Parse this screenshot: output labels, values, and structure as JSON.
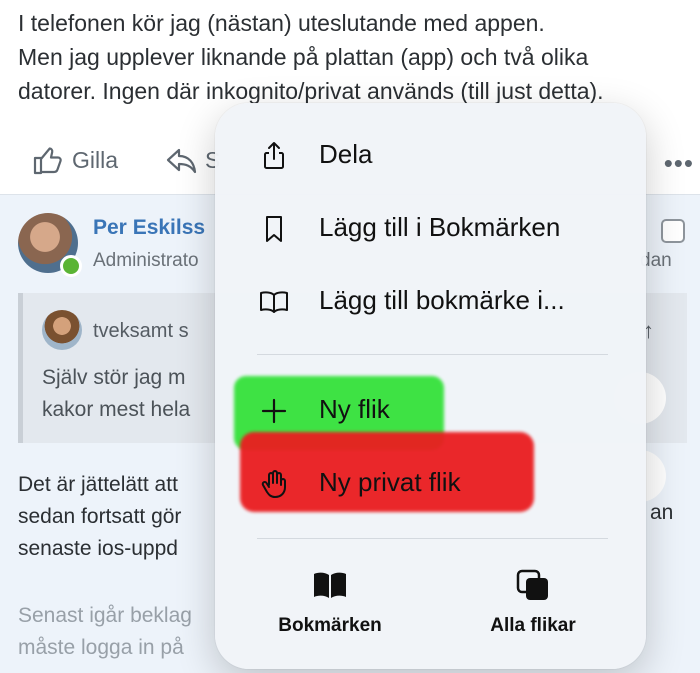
{
  "post": {
    "lines": [
      "I telefonen kör jag (nästan) uteslutande med appen.",
      "Men jag upplever liknande på plattan (app) och två olika",
      "datorer. Ingen där inkognito/privat används (till just detta)."
    ]
  },
  "actions": {
    "like_label": "Gilla",
    "reply_partial": "S",
    "more": "•••"
  },
  "reply": {
    "author": "Per Eskilss",
    "role": "Administrato",
    "date_partial": "dan",
    "quote": {
      "author": "tveksamt s",
      "lines": [
        "Själv stör jag m",
        "kakor mest hela"
      ]
    },
    "body_lines": [
      "Det är jättelätt att",
      "sedan fortsatt gör",
      "senaste ios-uppd"
    ],
    "body_right_fragment": "an",
    "faded_lines": [
      "Senast igår beklag",
      "måste logga in på"
    ]
  },
  "menu": {
    "items": [
      {
        "label": "Dela",
        "icon": "share-icon"
      },
      {
        "label": "Lägg till i Bokmärken",
        "icon": "bookmark-icon"
      },
      {
        "label": "Lägg till bokmärke i...",
        "icon": "open-book-icon"
      },
      {
        "label": "Ny flik",
        "icon": "plus-icon"
      },
      {
        "label": "Ny privat flik",
        "icon": "hand-icon"
      }
    ],
    "bottom": [
      {
        "label": "Bokmärken",
        "icon": "bookmarks-book-icon"
      },
      {
        "label": "Alla flikar",
        "icon": "all-tabs-icon"
      }
    ],
    "highlight_colors": {
      "green": "#35e23b",
      "red": "#ea1d20"
    }
  }
}
